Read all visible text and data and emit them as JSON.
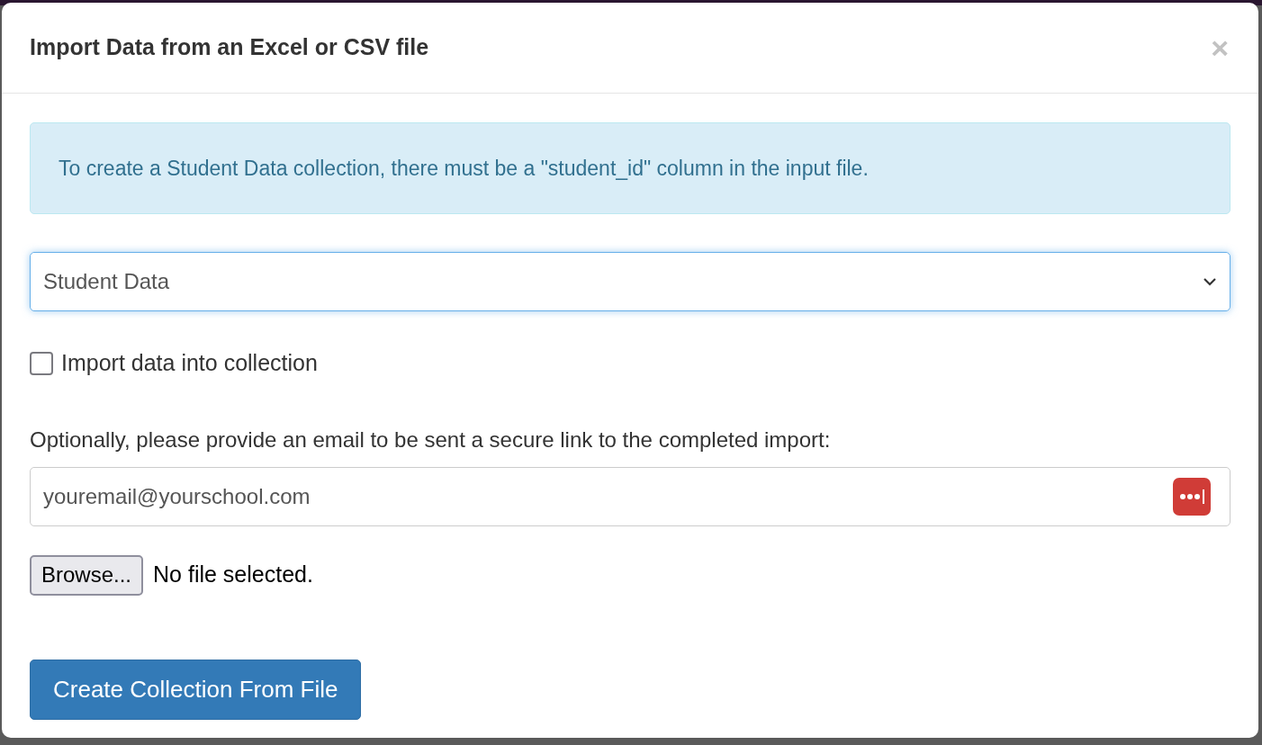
{
  "modal": {
    "title": "Import Data from an Excel or CSV file",
    "close": "×"
  },
  "alert": "To create a Student Data collection, there must be a \"student_id\" column in the input file.",
  "collection_select": {
    "value": "Student Data",
    "focused": true
  },
  "import_checkbox": {
    "label": "Import data into collection",
    "checked": false
  },
  "email": {
    "label": "Optionally, please provide an email to be sent a secure link to the completed import:",
    "value": "youremail@yourschool.com"
  },
  "file_input": {
    "button": "Browse...",
    "status": "No file selected."
  },
  "submit_button": "Create Collection From File"
}
